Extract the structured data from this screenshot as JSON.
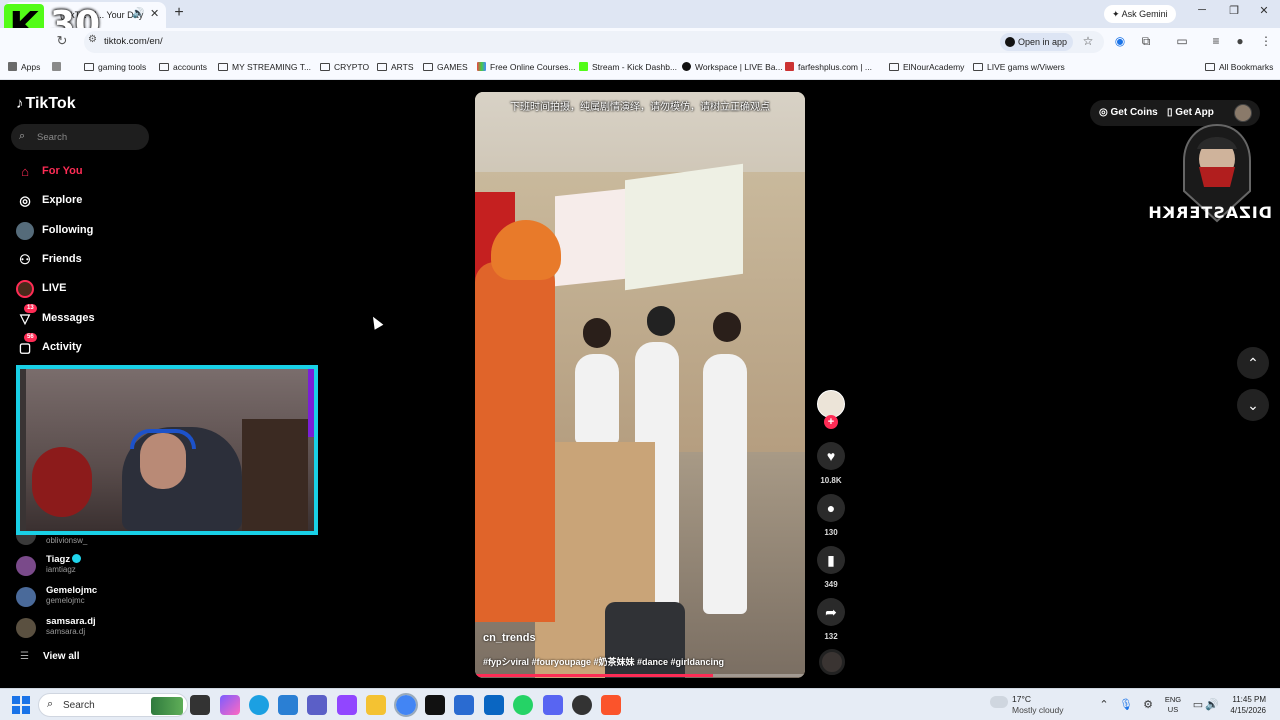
{
  "browser": {
    "tab": {
      "title": "(TikT... M... Your Day"
    },
    "ask_gemini": "Ask Gemini",
    "url": "tiktok.com/en/",
    "open_in_app": "Open in app",
    "bookmarks": [
      {
        "label": "Apps",
        "icon": "apps-grid-icon"
      },
      {
        "label": "gaming tools",
        "icon": "folder-icon"
      },
      {
        "label": "accounts",
        "icon": "folder-icon"
      },
      {
        "label": "MY STREAMING T...",
        "icon": "folder-icon"
      },
      {
        "label": "CRYPTO",
        "icon": "folder-icon"
      },
      {
        "label": "ARTS",
        "icon": "folder-icon"
      },
      {
        "label": "GAMES",
        "icon": "folder-icon"
      },
      {
        "label": "Free Online Courses...",
        "icon": "site-icon"
      },
      {
        "label": "Stream - Kick Dashb...",
        "icon": "kick-icon"
      },
      {
        "label": "Workspace | LIVE Ba...",
        "icon": "tiktok-icon"
      },
      {
        "label": "farfeshplus.com | ...",
        "icon": "site-icon"
      },
      {
        "label": "ElNourAcademy",
        "icon": "folder-icon"
      },
      {
        "label": "LIVE gams w/Viwers",
        "icon": "folder-icon"
      },
      {
        "label": "All Bookmarks",
        "icon": "folder-icon"
      }
    ]
  },
  "overlay": {
    "kick_number": "30",
    "kick_letter": "K",
    "streamer_name": "DIZASTERKH"
  },
  "sidebar": {
    "logo": "TikTok",
    "search_placeholder": "Search",
    "nav": [
      {
        "label": "For You",
        "icon": "home-icon",
        "active": true
      },
      {
        "label": "Explore",
        "icon": "compass-icon"
      },
      {
        "label": "Following",
        "icon": "following-icon"
      },
      {
        "label": "Friends",
        "icon": "friends-icon"
      },
      {
        "label": "LIVE",
        "icon": "live-icon"
      },
      {
        "label": "Messages",
        "icon": "messages-icon",
        "badge": "13"
      },
      {
        "label": "Activity",
        "icon": "activity-icon",
        "badge": "56"
      }
    ],
    "following_accounts": [
      {
        "name": "",
        "handle": "oblivionsw_"
      },
      {
        "name": "Tiagz",
        "handle": "iamtiagz",
        "verified": true
      },
      {
        "name": "Gemelojmc",
        "handle": "gemelojmc"
      },
      {
        "name": "samsara.dj",
        "handle": "samsara.dj"
      }
    ],
    "view_all": "View all"
  },
  "video": {
    "caption_cn": "下班时间拍摄，纯属剧情演绎，请勿模仿，请树立正确观点",
    "author": "cn_trends",
    "hashtags": "#fypシviral #fouryoupage #奶茶妹妹 #dance #girldancing",
    "progress": 0.72,
    "likes": "10.8K",
    "comments": "130",
    "saves": "349",
    "shares": "132"
  },
  "topbar": {
    "get_coins": "Get Coins",
    "get_app": "Get App"
  },
  "taskbar": {
    "search_label": "Search",
    "weather_temp": "17°C",
    "weather_cond": "Mostly cloudy",
    "lang_top": "ENG",
    "lang_bottom": "US",
    "time": "11:45 PM",
    "date": "4/15/2026"
  }
}
